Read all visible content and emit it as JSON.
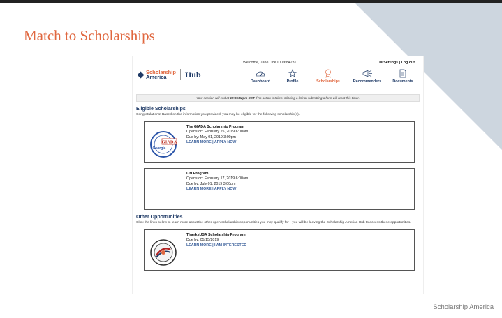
{
  "slide": {
    "title": "Match to Scholarships",
    "footer": "Scholarship America"
  },
  "header": {
    "welcome": "Welcome, Jane Doe  ID #684231",
    "settings": "Settings",
    "separator": " | ",
    "logout": "Log out",
    "logo_top": "Scholarship",
    "logo_bottom": "America",
    "hub": "Hub"
  },
  "nav": [
    {
      "label": "Dashboard",
      "icon": "gauge-icon"
    },
    {
      "label": "Profile",
      "icon": "star-icon"
    },
    {
      "label": "Scholarships",
      "icon": "ribbon-icon",
      "active": true
    },
    {
      "label": "Recommenders",
      "icon": "megaphone-icon"
    },
    {
      "label": "Documents",
      "icon": "document-icon"
    }
  ],
  "session": {
    "prefix": "Your session will end at ",
    "time": "12:35:52pm CDT",
    "suffix": " if no action is taken. Clicking a link or submitting a form will reset this timer."
  },
  "eligible": {
    "title": "Eligible Scholarships",
    "desc": "Congratulations! Based on the information you provided, you may be eligible for the following scholarship(s).",
    "cards": [
      {
        "title": "The GIADA Scholarship Program",
        "opens": "Opens on: February 25, 2019 6:00am",
        "due": "Due by: May 01, 2019 3:00pm",
        "learn": "LEARN MORE",
        "sep": " | ",
        "action": "APPLY NOW",
        "logo_text": "GIADA",
        "logo_sub": "Georgia"
      },
      {
        "title": "IJH Program",
        "opens": "Opens on: February 17, 2019 6:00am",
        "due": "Due by: July 01, 2019 3:00pm",
        "learn": "LEARN MORE",
        "sep": " | ",
        "action": "APPLY NOW"
      }
    ]
  },
  "other": {
    "title": "Other Opportunities",
    "desc": "Click the links below to learn more about the other open scholarship opportunities you may qualify for—you will be leaving the Scholarship America Hub to access these opportunities.",
    "cards": [
      {
        "title": "ThanksUSA Scholarship Program",
        "due": "Due by: 05/15/2019",
        "learn": "LEARN MORE",
        "sep": " | ",
        "action": "I AM INTERESTED"
      }
    ]
  },
  "colors": {
    "accent": "#e0673f",
    "brand": "#1f3a66",
    "link": "#3a5f9a"
  }
}
